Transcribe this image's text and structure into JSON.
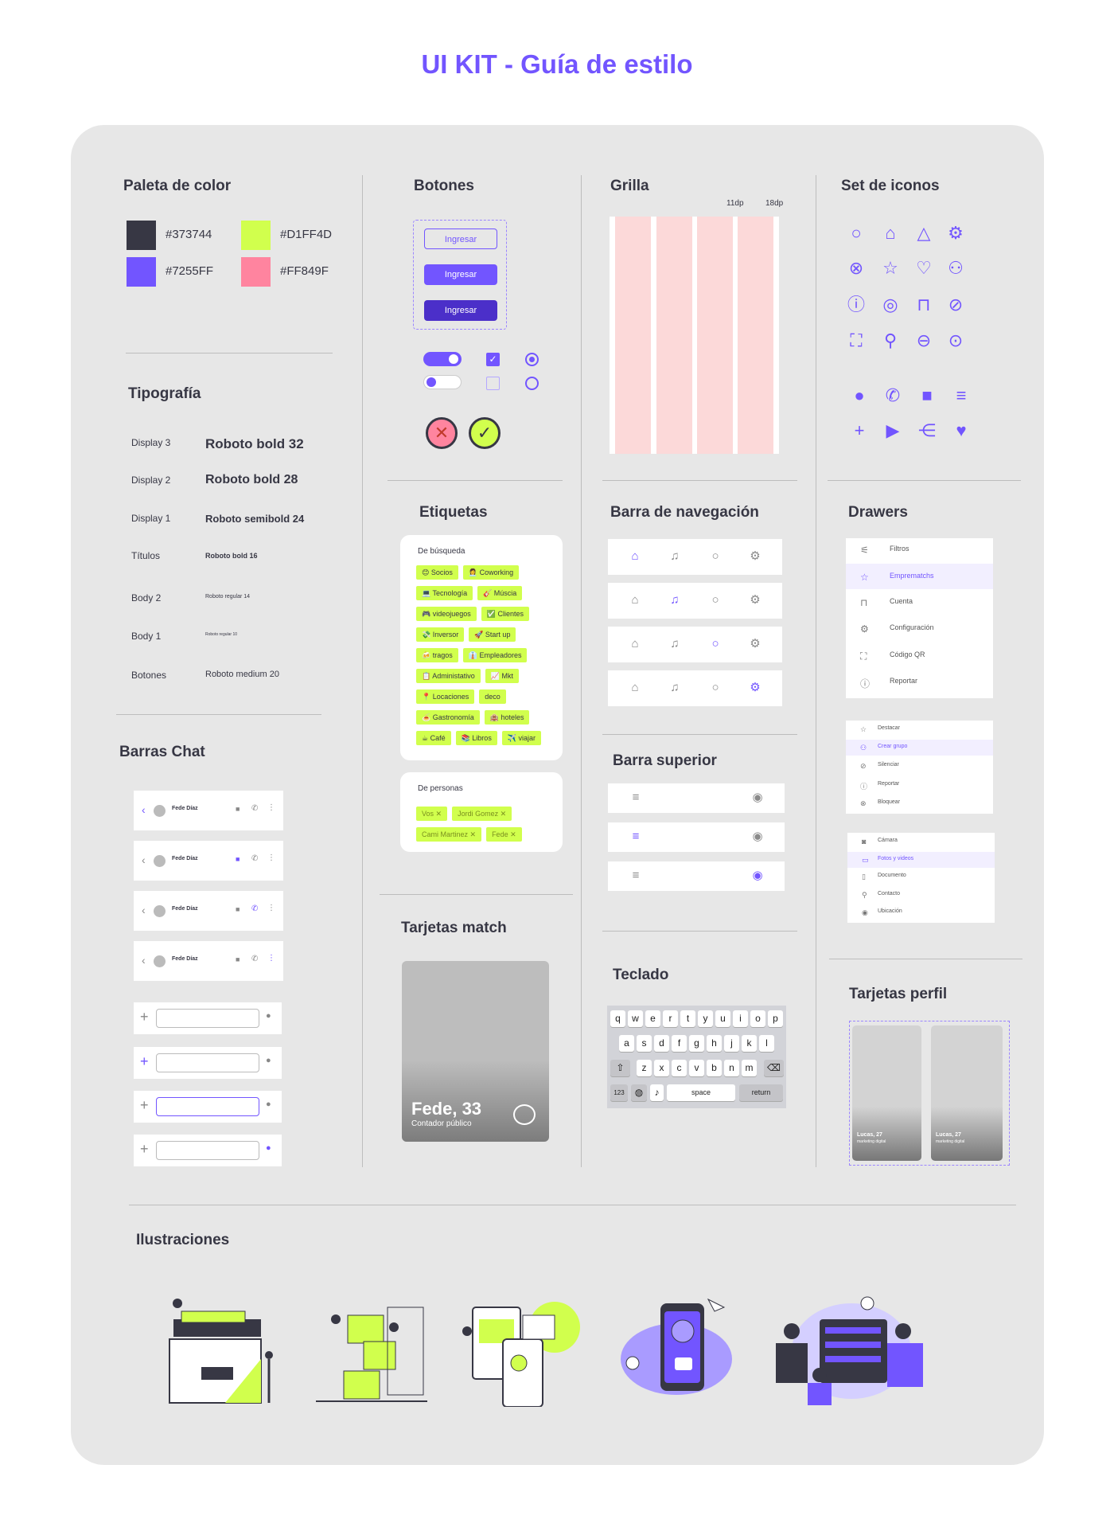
{
  "title": "UI KIT - Guía de estilo",
  "sections": {
    "palette": "Paleta de color",
    "typography": "Tipografía",
    "chat_bars": "Barras Chat",
    "buttons": "Botones",
    "tags": "Etiquetas",
    "match_cards": "Tarjetas match",
    "grid": "Grilla",
    "navbar": "Barra de navegación",
    "topbar": "Barra superior",
    "keyboard": "Teclado",
    "icons": "Set de iconos",
    "drawers": "Drawers",
    "profile_cards": "Tarjetas perfil",
    "illustrations": "Ilustraciones"
  },
  "palette": [
    {
      "hex": "#373744",
      "color": "#373744"
    },
    {
      "hex": "#D1FF4D",
      "color": "#D1FF4D"
    },
    {
      "hex": "#7255FF",
      "color": "#7255FF"
    },
    {
      "hex": "#FF849F",
      "color": "#FF849F"
    }
  ],
  "typography": [
    {
      "name": "Display 3",
      "sample": "Roboto bold 32"
    },
    {
      "name": "Display 2",
      "sample": "Roboto bold 28"
    },
    {
      "name": "Display 1",
      "sample": "Roboto semibold 24"
    },
    {
      "name": "Títulos",
      "sample": "Roboto bold 16"
    },
    {
      "name": "Body 2",
      "sample": "Roboto regular 14"
    },
    {
      "name": "Body 1",
      "sample": "Roboto regular 10"
    },
    {
      "name": "Botones",
      "sample": "Roboto medium 20"
    }
  ],
  "buttons": {
    "label": "Ingresar"
  },
  "chat": {
    "contact_name": "Fede Díaz"
  },
  "tags": {
    "search_title": "De búsqueda",
    "search": [
      [
        "😊 Socios",
        "👩‍💼 Coworking"
      ],
      [
        "💻 Tecnología",
        "🎸 Múscia"
      ],
      [
        "🎮 videojuegos",
        "✅ Clientes"
      ],
      [
        "💸 Inversor",
        "🚀 Start up"
      ],
      [
        "🍻 tragos",
        "👔 Empleadores"
      ],
      [
        "📋 Administativo",
        "📈 Mkt"
      ],
      [
        "📍 Locaciones",
        "deco"
      ],
      [
        "🍝 Gastronomía",
        "🏨 hoteles"
      ],
      [
        "☕ Café",
        "📚 Libros",
        "✈️ viajar"
      ]
    ],
    "people_title": "De personas",
    "people": [
      [
        "Vos",
        "Jordi Gomez"
      ],
      [
        "Cami Martinez",
        "Fede"
      ]
    ]
  },
  "match_card": {
    "name": "Fede, 33",
    "role": "Contador público"
  },
  "grid": {
    "gutter_label": "11dp",
    "margin_label": "18dp"
  },
  "keyboard": {
    "row1": [
      "q",
      "w",
      "e",
      "r",
      "t",
      "y",
      "u",
      "i",
      "o",
      "p"
    ],
    "row2": [
      "a",
      "s",
      "d",
      "f",
      "g",
      "h",
      "j",
      "k",
      "l"
    ],
    "row3": [
      "z",
      "x",
      "c",
      "v",
      "b",
      "n",
      "m"
    ],
    "numbers": "123",
    "space": "space",
    "return": "return"
  },
  "drawer1": [
    "Filtros",
    "Emprematchs",
    "Cuenta",
    "Configuración",
    "Código QR",
    "Reportar"
  ],
  "drawer2": [
    "Destacar",
    "Crear grupo",
    "Silenciar",
    "Reportar",
    "Bloquear"
  ],
  "drawer3": [
    "Cámara",
    "Fotos y videos",
    "Documento",
    "Contacto",
    "Ubicación"
  ],
  "profile_cards": [
    {
      "name": "Lucas, 27",
      "role": "marketing digital"
    },
    {
      "name": "Lucas, 27",
      "role": "marketing digital"
    }
  ],
  "colors": {
    "primary": "#7255FF",
    "dark": "#373744",
    "lime": "#D1FF4D",
    "pink": "#FF849F",
    "deep_violet": "#4B2FC9"
  }
}
